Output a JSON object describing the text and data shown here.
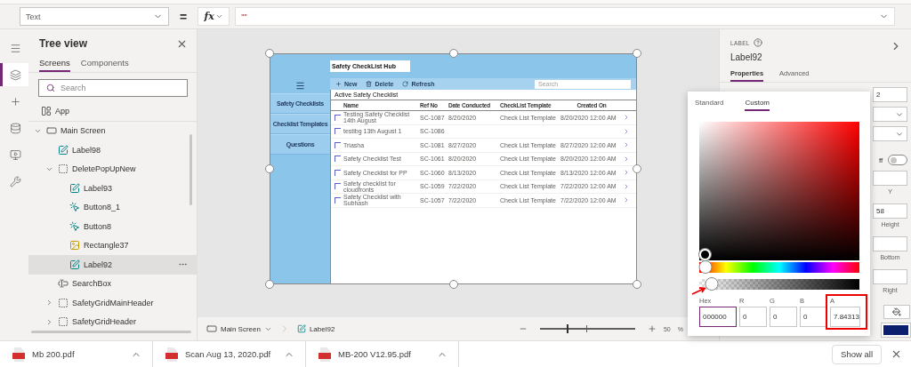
{
  "formula_bar": {
    "property": "Text",
    "operator": "=",
    "fx": "fx",
    "formula": "\"\""
  },
  "rail": [
    {
      "kind": "menu",
      "selected": false
    },
    {
      "kind": "layers",
      "selected": true
    },
    {
      "kind": "insert",
      "selected": false
    },
    {
      "kind": "data",
      "selected": false
    },
    {
      "kind": "media",
      "selected": false
    },
    {
      "kind": "tools",
      "selected": false
    }
  ],
  "tree_view": {
    "title": "Tree view",
    "tabs": [
      {
        "label": "Screens",
        "selected": true
      },
      {
        "label": "Components",
        "selected": false
      }
    ],
    "search": {
      "placeholder": "Search"
    },
    "app": {
      "label": "App",
      "selected": false
    },
    "items": [
      {
        "label": "Main Screen",
        "kind": "screen",
        "selected": false,
        "expanded": true,
        "children": [
          {
            "label": "Label98",
            "kind": "label",
            "selected": false
          },
          {
            "label": "DeletePopUpNew",
            "kind": "group",
            "selected": false,
            "expanded": true,
            "children": [
              {
                "label": "Label93",
                "kind": "label",
                "selected": false
              },
              {
                "label": "Button8_1",
                "kind": "button",
                "selected": false
              },
              {
                "label": "Button8",
                "kind": "button",
                "selected": false
              },
              {
                "label": "Rectangle37",
                "kind": "shape",
                "selected": false
              },
              {
                "label": "Label92",
                "kind": "label",
                "selected": true
              }
            ]
          },
          {
            "label": "SearchBox",
            "kind": "search",
            "selected": false
          },
          {
            "label": "SafetyGridMainHeader",
            "kind": "group",
            "selected": false,
            "expanded": false
          },
          {
            "label": "SafetyGridHeader",
            "kind": "group",
            "selected": false,
            "expanded": false
          }
        ]
      }
    ]
  },
  "canvas_app": {
    "title": "Safety CheckList Hub",
    "nav": [
      {
        "label": "Safety Checklists"
      },
      {
        "label": "Checklist Templates"
      },
      {
        "label": "Questions"
      }
    ],
    "toolbar": [
      {
        "kind": "new",
        "label": "New"
      },
      {
        "kind": "delete",
        "label": "Delete"
      },
      {
        "kind": "refresh",
        "label": "Refresh"
      }
    ],
    "search": {
      "placeholder": "Search"
    },
    "section_title": "Active Safety Checklist",
    "columns": [
      "Name",
      "Ref No",
      "Date Conducted",
      "CheckList Template",
      "Created On"
    ],
    "rows": [
      {
        "checked": false,
        "name": "Testing Safety Checklist 14th August",
        "ref": "SC-1087",
        "date": "8/20/2020",
        "template": "Check List Template",
        "created": "8/20/2020 12:00 AM"
      },
      {
        "checked": false,
        "name": "testibg 13th August 1",
        "ref": "SC-1086"
      },
      {
        "checked": false,
        "name": "Triasha",
        "ref": "SC-1081",
        "date": "8/27/2020",
        "template": "Check List Template",
        "created": "8/27/2020 12:00 AM"
      },
      {
        "checked": false,
        "name": "Safety Checklist Test",
        "ref": "SC-1061",
        "date": "8/20/2020",
        "template": "Check List Template",
        "created": "8/20/2020 12:00 AM"
      },
      {
        "checked": false,
        "name": "Safety Checklist for PP",
        "ref": "SC-1060",
        "date": "8/13/2020",
        "template": "Check List Template",
        "created": "8/13/2020 12:00 AM"
      },
      {
        "checked": false,
        "name": "Safety checklist for cloudfronts",
        "ref": "SC-1059",
        "date": "7/22/2020",
        "template": "Check List Template",
        "created": "7/22/2020 12:00 AM"
      },
      {
        "checked": false,
        "name": "Safety Checklist with Subhash",
        "ref": "SC-1057",
        "date": "7/22/2020",
        "template": "Check List Template",
        "created": "7/22/2020 12:00 AM"
      }
    ]
  },
  "status_bar": {
    "screen": "Main Screen",
    "control": "Label92",
    "zoom": {
      "level": 0.28
    },
    "zoom_value": "50",
    "zoom_unit": "%"
  },
  "right_panel": {
    "type_label": "LABEL",
    "control_name": "Label92",
    "tabs": [
      {
        "label": "Properties",
        "selected": true
      },
      {
        "label": "Advanced",
        "selected": false
      }
    ],
    "properties": [
      {
        "kind": "field",
        "value": "2"
      },
      {
        "kind": "dropdown"
      },
      {
        "kind": "dropdown"
      },
      {
        "kind": "toggle",
        "label": "ff",
        "on": false
      },
      {
        "kind": "field"
      },
      {
        "kind": "caption",
        "label": "Y"
      },
      {
        "kind": "field",
        "value": "58"
      },
      {
        "kind": "caption",
        "label": "Height"
      },
      {
        "kind": "field"
      },
      {
        "kind": "caption",
        "label": "Bottom"
      },
      {
        "kind": "field"
      },
      {
        "kind": "caption",
        "label": "Right"
      },
      {
        "kind": "colors",
        "color": "#0b1f6e"
      }
    ]
  },
  "color_picker": {
    "tabs": [
      {
        "label": "Standard",
        "selected": false
      },
      {
        "label": "Custom",
        "selected": true
      }
    ],
    "hue": {
      "level": 0
    },
    "alpha": {
      "level": 0.08
    },
    "fields": [
      {
        "label": "Hex",
        "value": "000000",
        "focused": true,
        "highlighted": false
      },
      {
        "label": "R",
        "value": "0",
        "focused": false,
        "highlighted": false
      },
      {
        "label": "G",
        "value": "0",
        "focused": false,
        "highlighted": false
      },
      {
        "label": "B",
        "value": "0",
        "focused": false,
        "highlighted": false
      },
      {
        "label": "A",
        "value": "7.84313",
        "focused": false,
        "highlighted": true
      }
    ]
  },
  "downloads": {
    "files": [
      {
        "name": "Mb 200.pdf"
      },
      {
        "name": "Scan Aug 13, 2020.pdf"
      },
      {
        "name": "MB-200 V12.95.pdf"
      }
    ],
    "show_all": "Show all"
  }
}
